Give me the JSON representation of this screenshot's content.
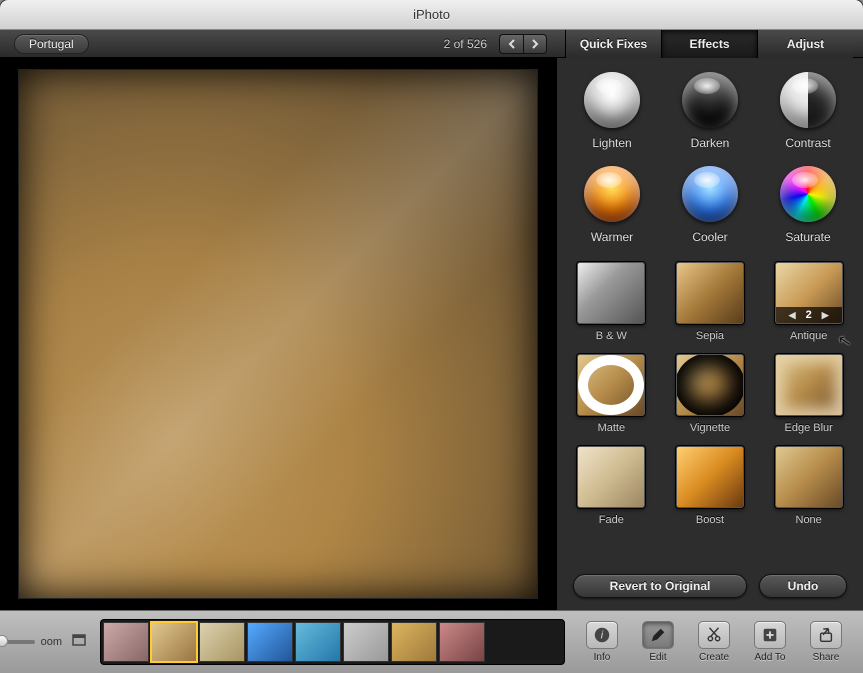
{
  "app": {
    "title": "iPhoto"
  },
  "header": {
    "album": "Portugal",
    "counter": "2 of 526"
  },
  "edit_tabs": {
    "quick_fixes": "Quick Fixes",
    "effects": "Effects",
    "adjust": "Adjust",
    "active": "effects"
  },
  "orbs": {
    "lighten": "Lighten",
    "darken": "Darken",
    "contrast": "Contrast",
    "warmer": "Warmer",
    "cooler": "Cooler",
    "saturate": "Saturate"
  },
  "effects": {
    "bw": "B & W",
    "sepia": "Sepia",
    "antique": "Antique",
    "matte": "Matte",
    "vignette": "Vignette",
    "edgeblur": "Edge Blur",
    "fade": "Fade",
    "boost": "Boost",
    "none": "None",
    "antique_value": "2"
  },
  "panel_buttons": {
    "revert": "Revert to Original",
    "undo": "Undo"
  },
  "bottom": {
    "zoom_label": "oom",
    "tools": {
      "info": "Info",
      "edit": "Edit",
      "create": "Create",
      "addto": "Add To",
      "share": "Share"
    }
  }
}
